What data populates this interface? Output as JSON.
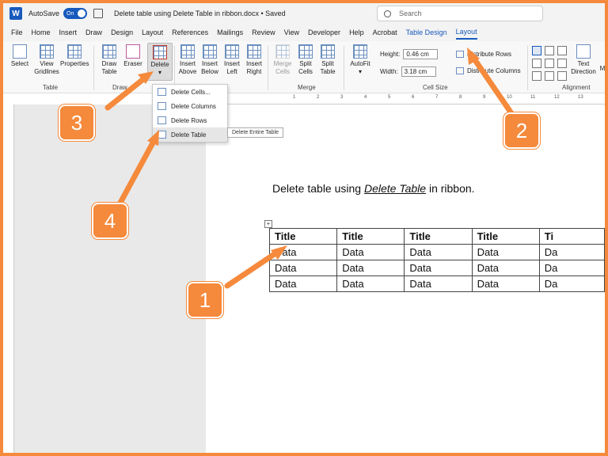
{
  "window": {
    "autosave_label": "AutoSave",
    "autosave_state": "On",
    "doc_title": "Delete table using Delete Table in ribbon.docx • Saved",
    "search_placeholder": "Search"
  },
  "tabs": [
    {
      "label": "File"
    },
    {
      "label": "Home"
    },
    {
      "label": "Insert"
    },
    {
      "label": "Draw"
    },
    {
      "label": "Design"
    },
    {
      "label": "Layout"
    },
    {
      "label": "References"
    },
    {
      "label": "Mailings"
    },
    {
      "label": "Review"
    },
    {
      "label": "View"
    },
    {
      "label": "Developer"
    },
    {
      "label": "Help"
    },
    {
      "label": "Acrobat"
    },
    {
      "label": "Table Design"
    },
    {
      "label": "Layout"
    }
  ],
  "ribbon": {
    "select": "Select",
    "view_gridlines_1": "View",
    "view_gridlines_2": "Gridlines",
    "properties": "Properties",
    "draw_table_1": "Draw",
    "draw_table_2": "Table",
    "eraser": "Eraser",
    "delete": "Delete",
    "insert_above_1": "Insert",
    "insert_above_2": "Above",
    "insert_below_1": "Insert",
    "insert_below_2": "Below",
    "insert_left_1": "Insert",
    "insert_left_2": "Left",
    "insert_right_1": "Insert",
    "insert_right_2": "Right",
    "merge_cells_1": "Merge",
    "merge_cells_2": "Cells",
    "split_cells_1": "Split",
    "split_cells_2": "Cells",
    "split_table_1": "Split",
    "split_table_2": "Table",
    "autofit": "AutoFit",
    "height_label": "Height:",
    "height_value": "0.46 cm",
    "width_label": "Width:",
    "width_value": "3.18 cm",
    "distribute_rows": "Distribute Rows",
    "distribute_columns": "Distribute Columns",
    "text_direction_1": "Text",
    "text_direction_2": "Direction",
    "cell_margins_1": "M",
    "group_table": "Table",
    "group_draw": "Draw",
    "group_merge": "Merge",
    "group_cell_size": "Cell Size",
    "group_alignment": "Alignment"
  },
  "ruler": [
    "1",
    "2",
    "3",
    "4",
    "5",
    "6",
    "7",
    "8",
    "9",
    "10",
    "11",
    "12",
    "13"
  ],
  "dropdown": {
    "items": [
      "Delete Cells...",
      "Delete Columns",
      "Delete Rows",
      "Delete Table"
    ]
  },
  "tooltip": "Delete Entire Table",
  "document": {
    "sentence_before": "Delete table using ",
    "sentence_em": "Delete Table",
    "sentence_after": " in ribbon.",
    "table_handle": "+",
    "table": [
      [
        "Title",
        "Title",
        "Title",
        "Title",
        "Ti"
      ],
      [
        "Data",
        "Data",
        "Data",
        "Data",
        "Da"
      ],
      [
        "Data",
        "Data",
        "Data",
        "Data",
        "Da"
      ],
      [
        "Data",
        "Data",
        "Data",
        "Data",
        "Da"
      ]
    ]
  },
  "callouts": {
    "c1": "1",
    "c2": "2",
    "c3": "3",
    "c4": "4"
  },
  "colors": {
    "accent": "#185abd",
    "callout": "#f58a3c"
  }
}
